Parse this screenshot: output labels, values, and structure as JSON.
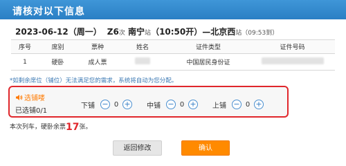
{
  "dialog": {
    "title": "请核对以下信息"
  },
  "trip": {
    "date": "2023-06-12（周一）",
    "train_no": "Z6",
    "train_suffix": "次",
    "from_station": "南宁",
    "station_suffix": "站",
    "depart": "（10:50开）—",
    "to_station": "北京西",
    "to_suffix": "站",
    "arrive": "（09:53到）"
  },
  "table": {
    "headers": [
      "序号",
      "席别",
      "票种",
      "姓名",
      "证件类型",
      "证件号码"
    ],
    "rows": [
      {
        "index": "1",
        "seat": "硬卧",
        "ticket": "成人票",
        "id_type": "中国居民身份证"
      }
    ]
  },
  "notice": "*如剩余席位（铺位）无法满足您的需求，系统将自动为您分配。",
  "berth_select": {
    "title": "选铺喽",
    "selected": "已选铺0/1",
    "lower_label": "下铺",
    "lower_count": "0",
    "middle_label": "中铺",
    "middle_count": "0",
    "upper_label": "上铺",
    "upper_count": "0",
    "minus": "−",
    "plus": "+"
  },
  "footnote": {
    "prefix": "本次列车，硬卧余票",
    "count": "17",
    "suffix": "张。"
  },
  "buttons": {
    "back": "返回修改",
    "confirm": "确认"
  },
  "colors": {
    "title_bar": "#2a7fc4",
    "highlight_border": "#e0262b",
    "confirm": "#ff8a00",
    "accent_text": "#ff7a00"
  }
}
